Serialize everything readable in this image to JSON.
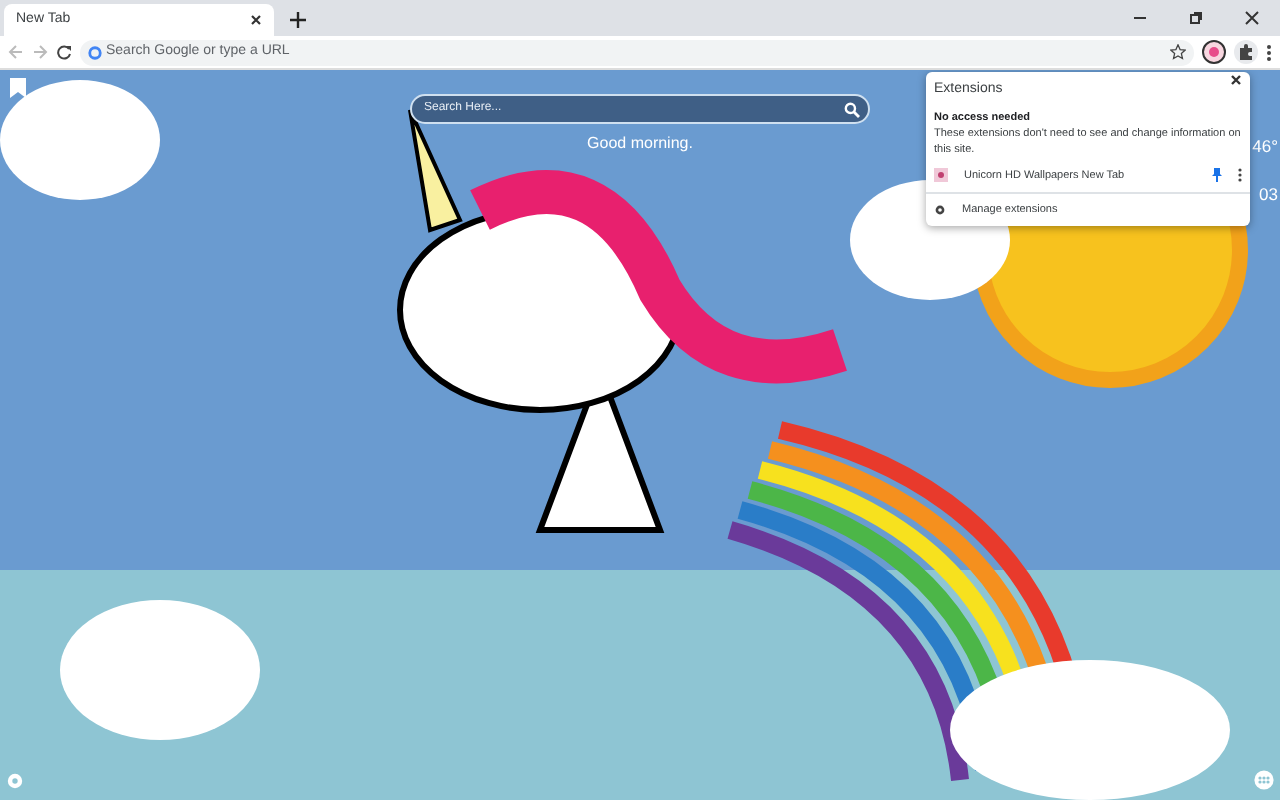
{
  "tabs": [
    {
      "title": "New Tab",
      "selected": true
    }
  ],
  "omnibox": {
    "placeholder": "Search Google or type a URL"
  },
  "search": {
    "placeholder": "Search Here..."
  },
  "greeting": "Good morning.",
  "weather": {
    "temperature": "46°",
    "time": "03"
  },
  "extensions_popup": {
    "title": "Extensions",
    "section_heading": "No access needed",
    "section_text": "These extensions don't need to see and change information on this site.",
    "items": [
      {
        "name": "Unicorn HD Wallpapers New Tab",
        "pinned": true
      }
    ],
    "manage_label": "Manage extensions"
  }
}
